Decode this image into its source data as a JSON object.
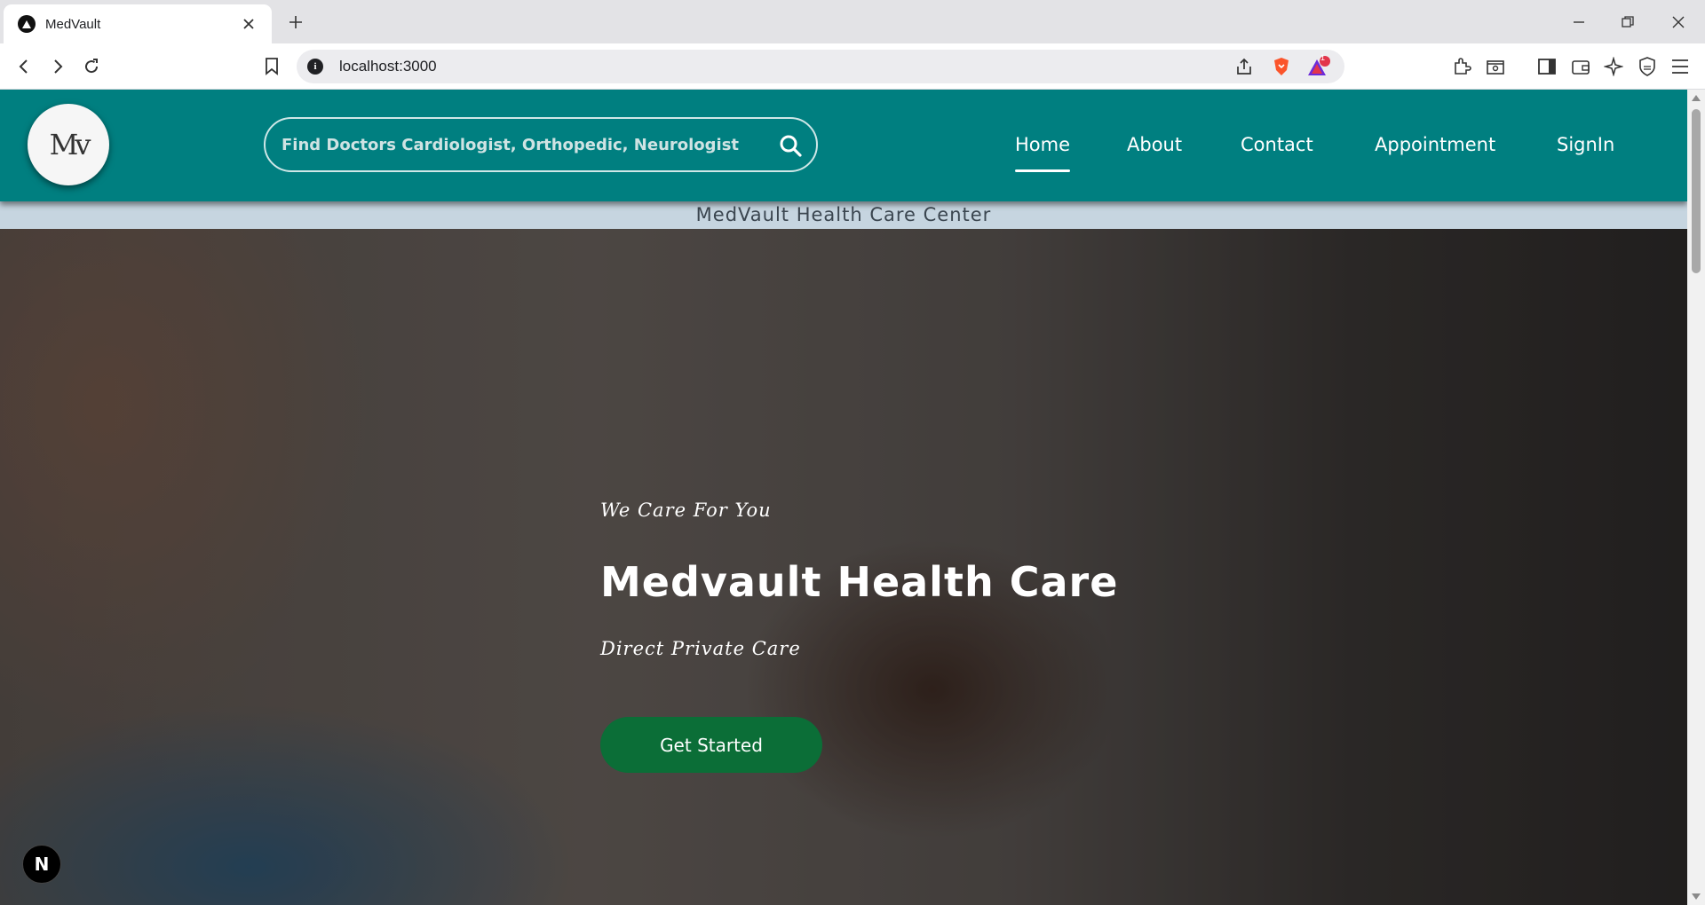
{
  "browser": {
    "tab_title": "MedVault",
    "url": "localhost:3000",
    "notification_count": "1"
  },
  "site": {
    "logo_text": "Mv",
    "search_placeholder": "Find Doctors Cardiologist, Orthopedic, Neurologist",
    "nav": {
      "home": "Home",
      "about": "About",
      "contact": "Contact",
      "appointment": "Appointment",
      "signin": "SignIn"
    },
    "active_nav": "home",
    "subbar_text": "MedVault Health Care Center",
    "colors": {
      "header": "#007f80",
      "cta": "#0b6e37",
      "subbar": "#c6d5e0"
    }
  },
  "hero": {
    "tagline": "We Care For You",
    "title": "Medvault Health Care",
    "subtitle": "Direct Private Care",
    "cta_label": "Get Started"
  },
  "dev_badge": "N"
}
